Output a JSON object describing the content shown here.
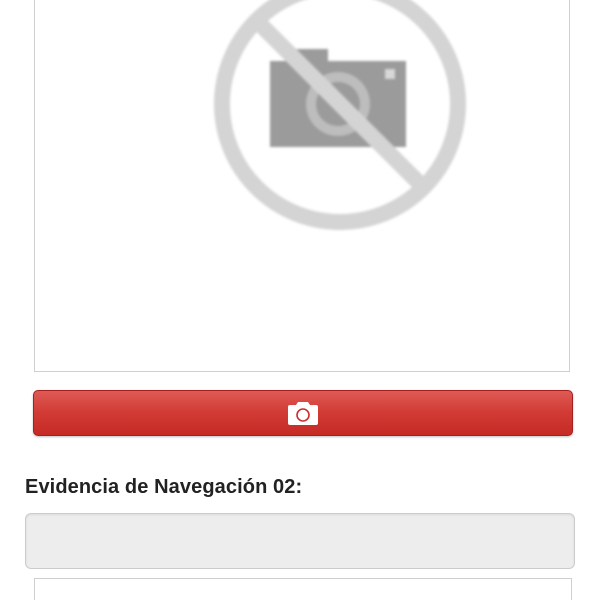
{
  "photo_preview": {
    "placeholder_icon": "no-photo-icon"
  },
  "camera_button": {
    "icon": "camera-icon",
    "color": "#d23b35"
  },
  "evidence_02": {
    "label": "Evidencia de Navegación 02:",
    "input_value": "",
    "input_placeholder": ""
  },
  "colors": {
    "accent": "#d23b35",
    "field_background": "#ededed",
    "border": "#cfcfcf"
  }
}
